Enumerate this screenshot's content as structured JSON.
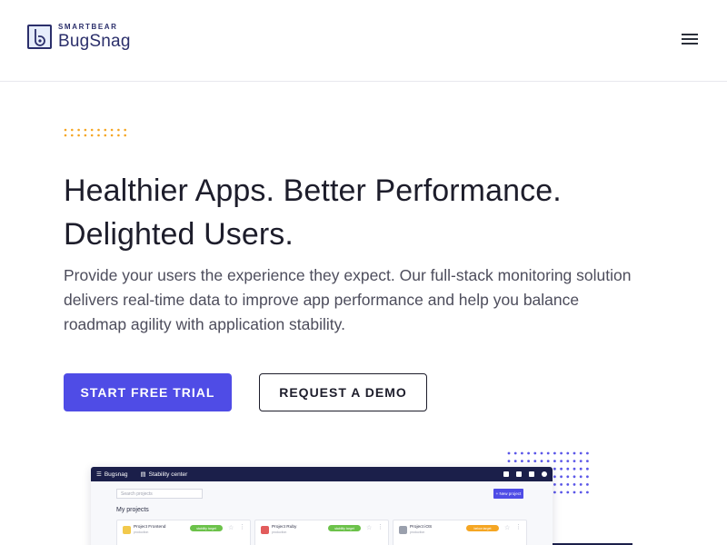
{
  "header": {
    "brand_small": "SMARTBEAR",
    "brand_main": "BugSnag",
    "menu_icon": "hamburger-menu-icon"
  },
  "hero": {
    "headline_line1": "Healthier Apps. Better Performance.",
    "headline_line2": "Delighted Users.",
    "subtext": "Provide your users the experience they expect. Our full-stack monitoring solution delivers real-time data to improve app performance and help you balance roadmap agility with application stability.",
    "primary_cta": "START FREE TRIAL",
    "secondary_cta": "REQUEST A DEMO"
  },
  "colors": {
    "accent": "#4f4ce6",
    "brand_dark": "#2b2f6b",
    "dots_orange": "#f5a623",
    "dots_purple": "#5b57e8"
  },
  "preview": {
    "app_name": "Bugsnag",
    "nav_item": "Stability center",
    "search_placeholder": "Search projects",
    "new_project_label": "+ New project",
    "heading": "My projects",
    "projects": [
      {
        "name": "Project Frontend",
        "sub": "production",
        "badge": "stability target",
        "badge_color": "#6cc24a",
        "icon_color": "#f2c94c"
      },
      {
        "name": "Project Ruby",
        "sub": "production",
        "badge": "stability target",
        "badge_color": "#6cc24a",
        "icon_color": "#e25c5c"
      },
      {
        "name": "Project iOS",
        "sub": "production",
        "badge": "below target",
        "badge_color": "#f5a623",
        "icon_color": "#9aa0ad"
      }
    ]
  }
}
